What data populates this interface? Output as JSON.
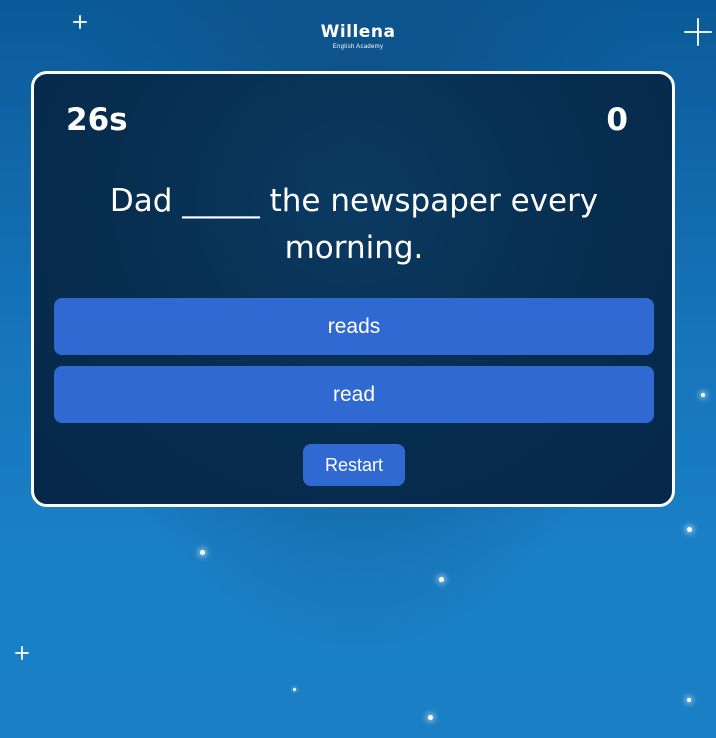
{
  "logo": {
    "name": "Willena",
    "subtitle": "English Academy"
  },
  "game": {
    "timer": "26s",
    "score": "0",
    "question": "Dad _____ the newspaper every morning.",
    "options": [
      {
        "label": "reads"
      },
      {
        "label": "read"
      }
    ],
    "restart_label": "Restart"
  },
  "colors": {
    "background": "#1674ba",
    "card": "#072d4e",
    "button": "#3069d2",
    "text": "#ffffff"
  }
}
